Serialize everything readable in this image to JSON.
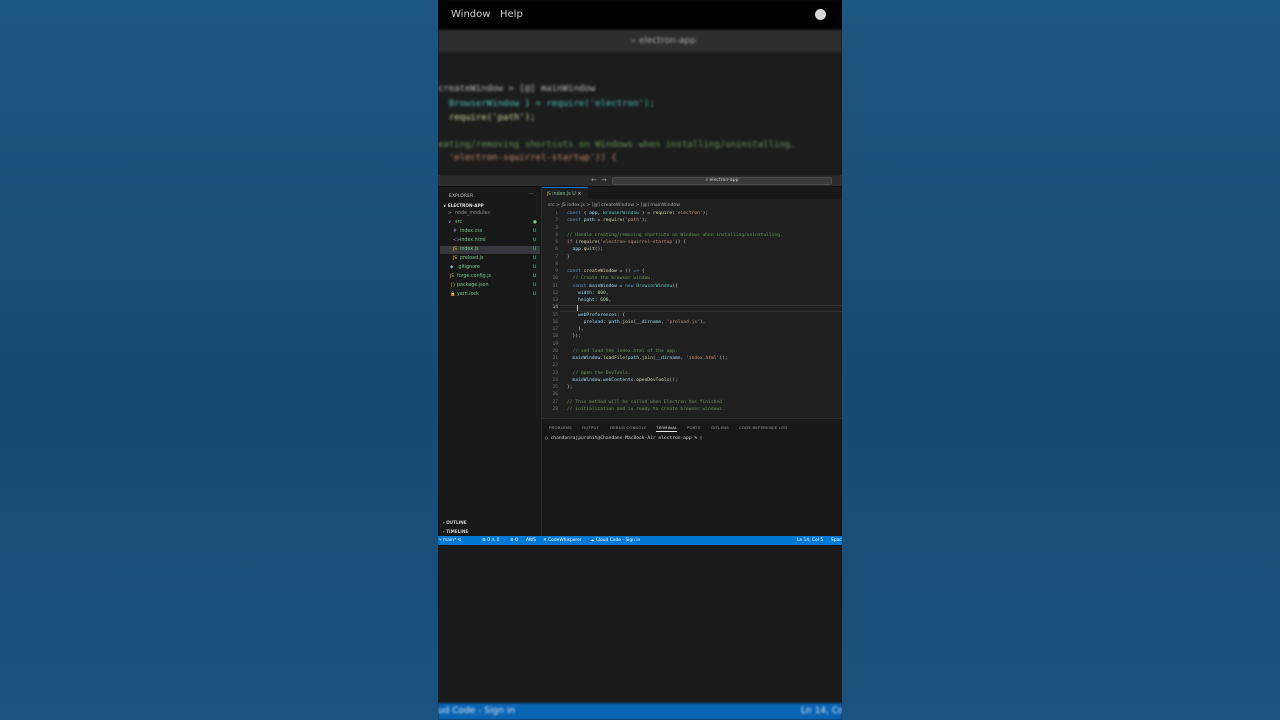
{
  "app": {
    "menu": [
      "Window",
      "Help"
    ],
    "search_title": "electron-app"
  },
  "blurred_top_code": [
    "createWindow > [@] mainWindow",
    "  BrowserWindow } = require('electron');",
    "  require('path');",
    "",
    "eating/removing shortcuts on Windows when installing/uninstalling.",
    "  'electron-squirrel-startup')) {"
  ],
  "titlebar": {
    "back": "←",
    "forward": "→",
    "search": "electron-app"
  },
  "sidebar": {
    "header": "EXPLORER",
    "more": "···",
    "project": "ELECTRON-APP",
    "items": [
      {
        "label": "node_modules",
        "icon": ">",
        "status": "",
        "color": "#8b8b8b"
      },
      {
        "label": "src",
        "icon": "∨",
        "status": "●",
        "color": "#73c991"
      },
      {
        "label": "index.css",
        "icon": "#",
        "status": "U",
        "color": "#73c991"
      },
      {
        "label": "index.html",
        "icon": "<>",
        "status": "U",
        "color": "#73c991"
      },
      {
        "label": "index.js",
        "icon": "JS",
        "status": "U",
        "color": "#73c991"
      },
      {
        "label": "preload.js",
        "icon": "JS",
        "status": "U",
        "color": "#73c991"
      },
      {
        "label": ".gitignore",
        "icon": "◆",
        "status": "U",
        "color": "#73c991"
      },
      {
        "label": "forge.config.js",
        "icon": "JS",
        "status": "U",
        "color": "#73c991"
      },
      {
        "label": "package.json",
        "icon": "{}",
        "status": "U",
        "color": "#73c991"
      },
      {
        "label": "yarn.lock",
        "icon": "🔒",
        "status": "U",
        "color": "#73c991"
      }
    ],
    "outline": "OUTLINE",
    "timeline": "TIMELINE"
  },
  "editor": {
    "tab_label": "index.js",
    "tab_status": "U",
    "tab_close": "×",
    "breadcrumbs": "src  >  JS index.js  >  [@] createWindow  >  [@] mainWindow",
    "current_line": 14,
    "lines": [
      {
        "n": "1",
        "html": "<span class='kw'>const</span> { <span class='var'>app</span>, <span class='cls'>BrowserWindow</span> } = <span class='fn'>require</span>(<span class='str'>'electron'</span>);"
      },
      {
        "n": "2",
        "html": "<span class='kw'>const</span> <span class='var'>path</span> = <span class='fn'>require</span>(<span class='str'>'path'</span>);"
      },
      {
        "n": "3",
        "html": ""
      },
      {
        "n": "4",
        "html": "<span class='cm'>// Handle creating/removing shortcuts on Windows when installing/uninstalling.</span>"
      },
      {
        "n": "5",
        "html": "<span class='kw2'>if</span> (<span class='fn'>require</span>(<span class='str'>'electron-squirrel-startup'</span>)) {"
      },
      {
        "n": "6",
        "html": "  <span class='var'>app</span>.<span class='fn'>quit</span>();"
      },
      {
        "n": "7",
        "html": "}"
      },
      {
        "n": "8",
        "html": ""
      },
      {
        "n": "9",
        "html": "<span class='kw'>const</span> <span class='fn'>createWindow</span> = () <span class='kw'>=&gt;</span> {"
      },
      {
        "n": "10",
        "html": "  <span class='cm'>// Create the browser window.</span>"
      },
      {
        "n": "11",
        "html": "  <span class='kw'>const</span> <span class='var'>mainWindow</span> = <span class='kw'>new</span> <span class='cls'>BrowserWindow</span>({"
      },
      {
        "n": "12",
        "html": "    <span class='var'>width</span>: <span class='num'>800</span>,"
      },
      {
        "n": "13",
        "html": "    <span class='var'>height</span>: <span class='num'>600</span>,"
      },
      {
        "n": "14",
        "html": ""
      },
      {
        "n": "15",
        "html": "    <span class='var'>webPreferences</span>: {"
      },
      {
        "n": "16",
        "html": "      <span class='var'>preload</span>: <span class='var'>path</span>.<span class='fn'>join</span>(<span class='var'>__dirname</span>, <span class='str'>'preload.js'</span>),"
      },
      {
        "n": "17",
        "html": "    },"
      },
      {
        "n": "18",
        "html": "  });"
      },
      {
        "n": "19",
        "html": ""
      },
      {
        "n": "20",
        "html": "  <span class='cm'>// and load the index.html of the app.</span>"
      },
      {
        "n": "21",
        "html": "  <span class='var'>mainWindow</span>.<span class='fn'>loadFile</span>(<span class='var'>path</span>.<span class='fn'>join</span>(<span class='var'>__dirname</span>, <span class='str'>'index.html'</span>));"
      },
      {
        "n": "22",
        "html": ""
      },
      {
        "n": "23",
        "html": "  <span class='cm'>// Open the DevTools.</span>"
      },
      {
        "n": "24",
        "html": "  <span class='var'>mainWindow</span>.<span class='var'>webContents</span>.<span class='fn'>openDevTools</span>();"
      },
      {
        "n": "25",
        "html": "};"
      },
      {
        "n": "26",
        "html": ""
      },
      {
        "n": "27",
        "html": "<span class='cm'>// This method will be called when Electron has finished</span>"
      },
      {
        "n": "28",
        "html": "<span class='cm'>// initialization and is ready to create browser windows.</span>"
      }
    ]
  },
  "panel": {
    "tabs": [
      "PROBLEMS",
      "OUTPUT",
      "DEBUG CONSOLE",
      "TERMINAL",
      "PORTS",
      "GITLENS",
      "CODE REFERENCE LOG"
    ],
    "active_tab": "TERMINAL",
    "terminal_line": "○ chandanrajpurohit@Chandans-MacBook-Air electron-app % ▯"
  },
  "statusbar": {
    "left": [
      "⑂ main* ⟲",
      "⊗ 0 ⚠ 0",
      "⊚ 0",
      "AWS",
      "✕ CodeWhisperer",
      "☁ Cloud Code - Sign in"
    ],
    "right": [
      "Ln 14, Col 5",
      "Spac"
    ]
  },
  "blurred_bottom_status": {
    "left": "ud Code - Sign in",
    "right": "Ln 14, Co"
  },
  "colors": {
    "accent": "#0078d4",
    "background": "#1a4f7a",
    "untracked": "#73c991"
  }
}
